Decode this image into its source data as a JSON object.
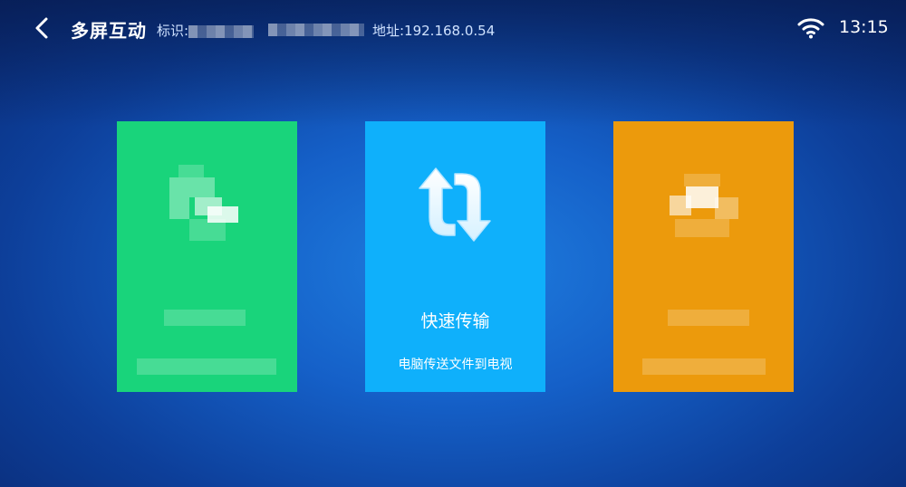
{
  "header": {
    "title": "多屏互动",
    "id_label": "标识:",
    "address_label": "地址:192.168.0.54",
    "time": "13:15"
  },
  "icons": {
    "back": "chevron-left-icon",
    "wifi": "wifi-icon",
    "transfer": "sync-arrows-icon"
  },
  "cards": [
    {
      "title": "",
      "subtitle": "",
      "color": "#19d47b"
    },
    {
      "title": "快速传输",
      "subtitle": "电脑传送文件到电视",
      "color": "#0fb0fb"
    },
    {
      "title": "",
      "subtitle": "",
      "color": "#ec9a0c"
    }
  ]
}
